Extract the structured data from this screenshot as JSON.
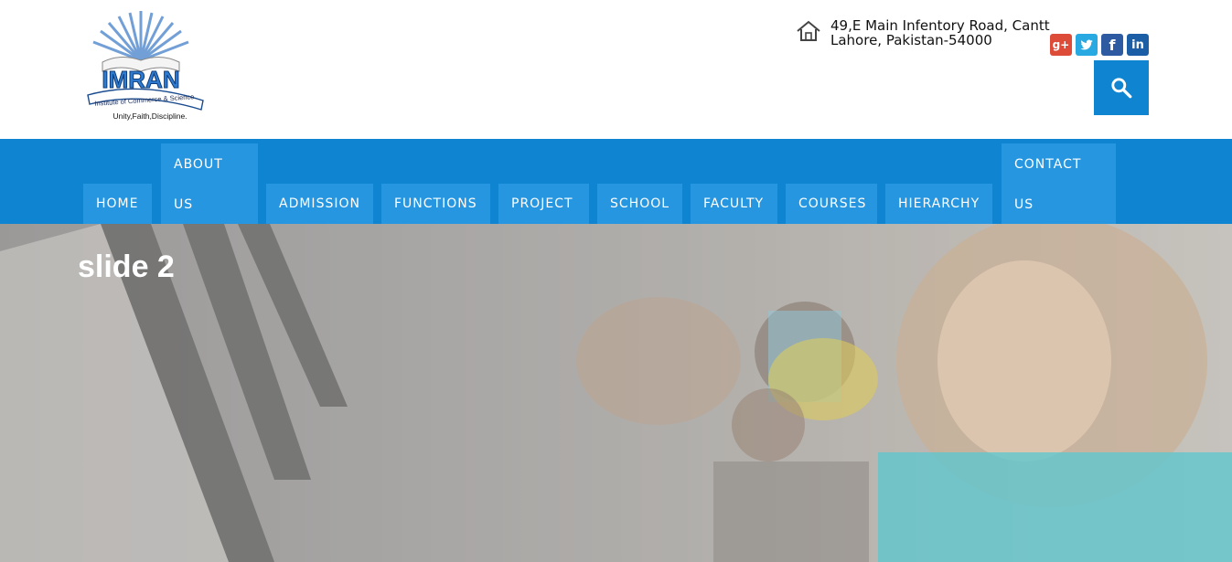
{
  "logo": {
    "name": "IMRAN",
    "tagline": "Institute of Commerce & Science",
    "motto": "Unity,Faith,Discipline."
  },
  "address": {
    "line1": "49,E Main Infentory Road, Cantt",
    "line2": "Lahore, Pakistan-54000"
  },
  "social": [
    {
      "name": "google-plus",
      "glyph": "g+"
    },
    {
      "name": "twitter",
      "glyph": "t"
    },
    {
      "name": "facebook",
      "glyph": "f"
    },
    {
      "name": "linkedin",
      "glyph": "in"
    }
  ],
  "nav": {
    "home": "HOME",
    "about_1": "ABOUT",
    "about_2": "US",
    "admission": "ADMISSION",
    "functions": "FUNCTIONS",
    "project": "PROJECT",
    "school": "SCHOOL",
    "faculty": "FACULTY",
    "courses": "COURSES",
    "hierarchy": "HIERARCHY",
    "contact_1": "CONTACT",
    "contact_2": "US"
  },
  "hero": {
    "title": "slide 2"
  },
  "colors": {
    "nav_bg": "#0f85d2",
    "nav_item_bg": "#2696e0"
  }
}
